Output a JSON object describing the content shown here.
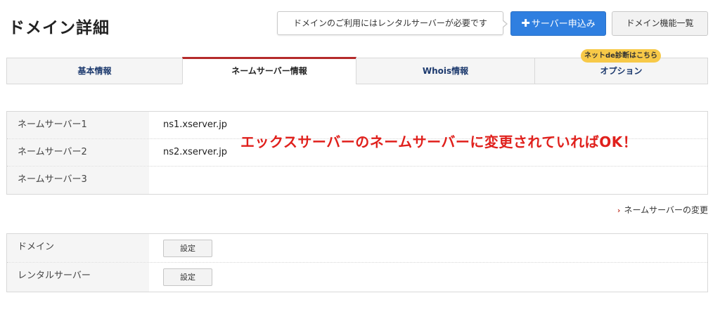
{
  "header": {
    "title": "ドメイン詳細",
    "notice": "ドメインのご利用にはレンタルサーバーが必要です",
    "primary_button": "サーバー申込み",
    "secondary_button": "ドメイン機能一覧"
  },
  "tabs": [
    {
      "label": "基本情報",
      "active": false
    },
    {
      "label": "ネームサーバー情報",
      "active": true
    },
    {
      "label": "Whois情報",
      "active": false
    },
    {
      "label": "オプション",
      "active": false,
      "badge": "ネットde診断はこちら"
    }
  ],
  "nameservers": {
    "rows": [
      {
        "label": "ネームサーバー1",
        "value": "ns1.xserver.jp"
      },
      {
        "label": "ネームサーバー2",
        "value": "ns2.xserver.jp"
      },
      {
        "label": "ネームサーバー3",
        "value": ""
      }
    ],
    "annotation": "エックスサーバーのネームサーバーに変更されていればOK！",
    "change_link": "ネームサーバーの変更"
  },
  "domain_settings": {
    "rows": [
      {
        "label": "ドメイン",
        "button": "設定"
      },
      {
        "label": "レンタルサーバー",
        "button": "設定"
      }
    ]
  },
  "colors": {
    "primary": "#2f7fe0",
    "active_tab_accent": "#b52a2a",
    "annotation": "#e0201c",
    "badge": "#f7c948"
  },
  "icons": {
    "plus": "plus-icon",
    "chevron": "chevron-right-icon"
  }
}
